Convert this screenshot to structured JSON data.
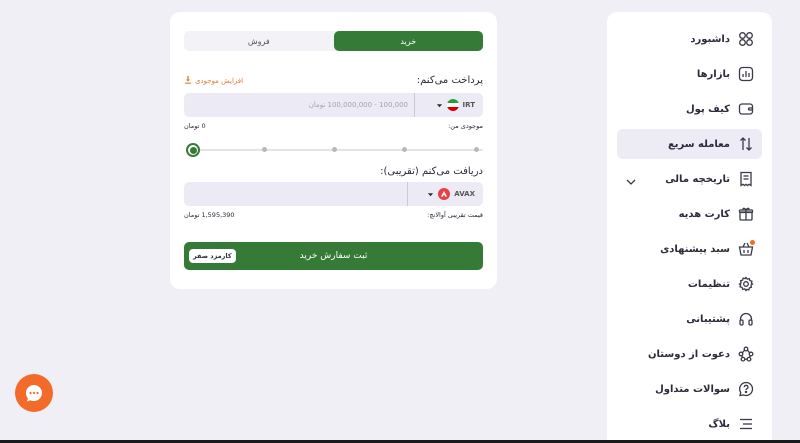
{
  "sidebar": {
    "items": [
      {
        "label": "داشبورد",
        "icon": "dashboard-icon"
      },
      {
        "label": "بازارها",
        "icon": "markets-icon"
      },
      {
        "label": "کیف پول",
        "icon": "wallet-icon"
      },
      {
        "label": "معامله سریع",
        "icon": "swap-arrows-icon"
      },
      {
        "label": "تاریخچه مالی",
        "icon": "receipt-icon"
      },
      {
        "label": "کارت هدیه",
        "icon": "gift-icon"
      },
      {
        "label": "سبد پیشنهادی",
        "icon": "basket-icon"
      },
      {
        "label": "تنظیمات",
        "icon": "gear-icon"
      },
      {
        "label": "پشتیبانی",
        "icon": "headset-icon"
      },
      {
        "label": "دعوت از دوستان",
        "icon": "network-icon"
      },
      {
        "label": "سوالات متداول",
        "icon": "question-bubble-icon"
      },
      {
        "label": "بلاگ",
        "icon": "list-icon"
      }
    ]
  },
  "trade": {
    "tabs": {
      "buy": "خرید",
      "sell": "فروش"
    },
    "pay": {
      "label": "پرداخت می‌کنم:",
      "increase_balance": "افزایش موجودی",
      "currency": "IRT",
      "placeholder": "100,000 - 100,000,000 تومان",
      "balance_label": "موجودی من:",
      "balance_value": "0 تومان"
    },
    "receive": {
      "label": "دریافت می‌کنم (تقریبی):",
      "currency": "AVAX",
      "price_label": "قیمت تقریبی آوالانچ:",
      "price_value": "1,595,390 تومان"
    },
    "slider": {
      "value": 0
    },
    "submit_label": "ثبت سفارش خرید",
    "fee_badge": "کارمزد صفر"
  },
  "colors": {
    "accent": "#367a38",
    "orange": "#f26b2b",
    "avax": "#e84142"
  }
}
